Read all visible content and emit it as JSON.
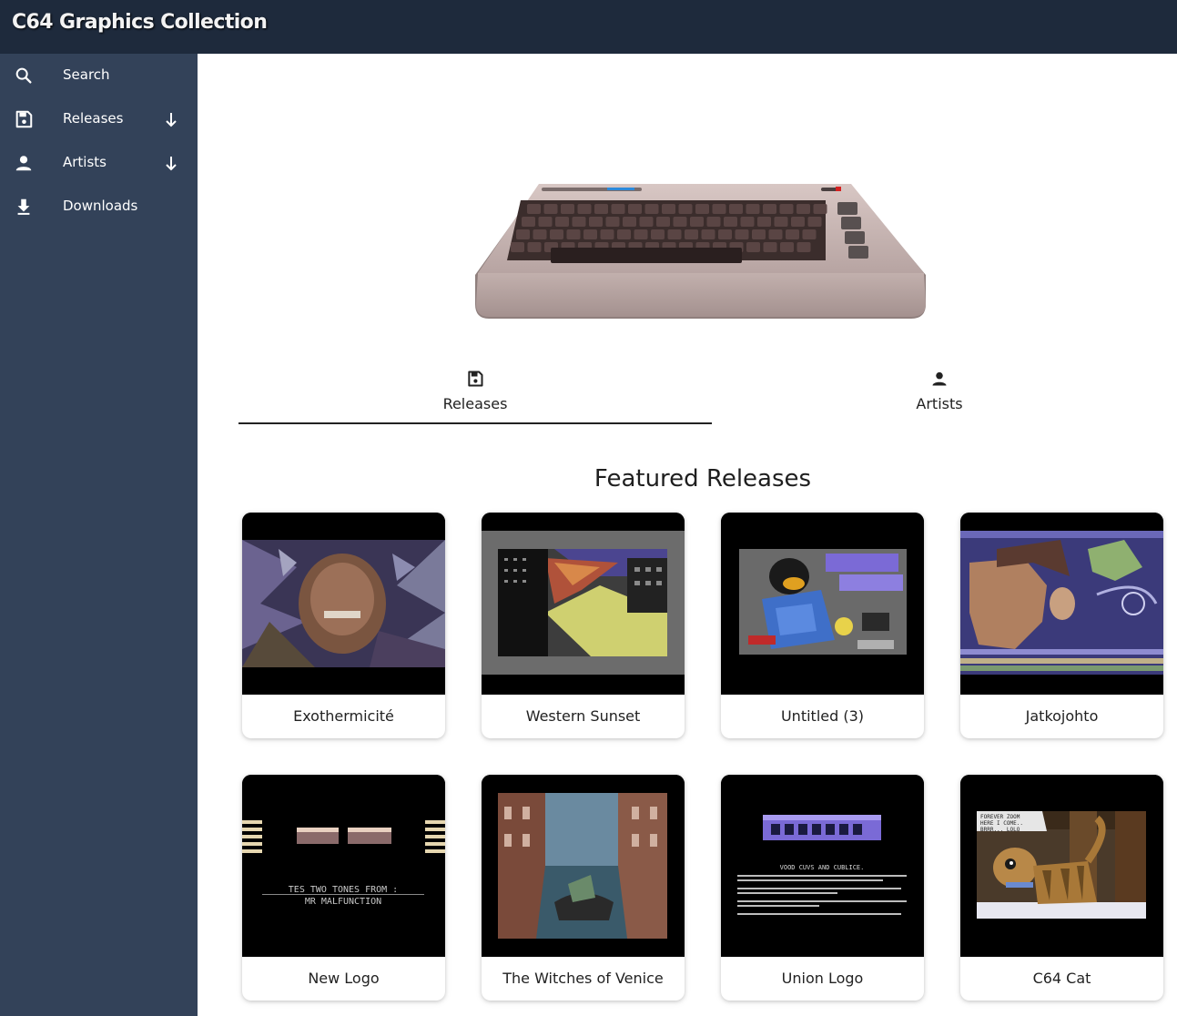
{
  "app": {
    "title": "C64 Graphics Collection"
  },
  "sidebar": {
    "items": [
      {
        "label": "Search",
        "icon": "search-icon",
        "expandable": false
      },
      {
        "label": "Releases",
        "icon": "floppy-disk-icon",
        "expandable": true
      },
      {
        "label": "Artists",
        "icon": "person-icon",
        "expandable": true
      },
      {
        "label": "Downloads",
        "icon": "download-icon",
        "expandable": false
      }
    ]
  },
  "tabs": [
    {
      "label": "Releases",
      "icon": "floppy-disk-icon",
      "selected": true
    },
    {
      "label": "Artists",
      "icon": "person-icon",
      "selected": false
    }
  ],
  "featured": {
    "title": "Featured Releases",
    "releases": [
      {
        "title": "Exothermicité"
      },
      {
        "title": "Western Sunset"
      },
      {
        "title": "Untitled (3)"
      },
      {
        "title": "Jatkojohto"
      },
      {
        "title": "New Logo",
        "image_text": [
          "TES TWO TONES FROM :",
          "MR MALFUNCTION"
        ]
      },
      {
        "title": "The Witches of Venice"
      },
      {
        "title": "Union Logo",
        "image_text": [
          "VOOD CUVS AND CUBLICE."
        ]
      },
      {
        "title": "C64 Cat",
        "image_text": [
          "FOREVER ZOOM",
          "HERE I COME..",
          "BRRR... LOLO"
        ]
      }
    ]
  },
  "colors": {
    "topbar": "#1e2a3c",
    "sidebar": "#334259",
    "accent": "#222222"
  }
}
